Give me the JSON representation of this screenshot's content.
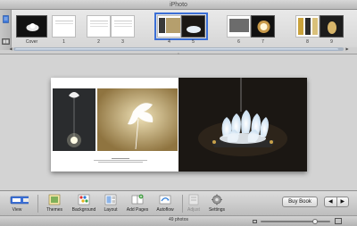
{
  "window": {
    "title": "iPhoto"
  },
  "pages": [
    {
      "label": "Cover"
    },
    {
      "label": "1"
    },
    {
      "label": "2"
    },
    {
      "label": "3"
    },
    {
      "label": "4"
    },
    {
      "label": "5"
    },
    {
      "label": "6"
    },
    {
      "label": "7"
    },
    {
      "label": "8"
    },
    {
      "label": "9"
    }
  ],
  "selected_spread": "4-5",
  "toolbar": {
    "view": "View",
    "themes": "Themes",
    "background": "Background",
    "layout": "Layout",
    "add_pages": "Add Pages",
    "autoflow": "Autoflow",
    "adjust": "Adjust",
    "settings": "Settings",
    "buy_book": "Buy Book",
    "prev": "◀",
    "next": "▶"
  },
  "status": {
    "photo_count": "49 photos",
    "zoom_level": 0.8
  },
  "colors": {
    "selection": "#3b6fd6",
    "toolbar": "#cfcfcf"
  }
}
